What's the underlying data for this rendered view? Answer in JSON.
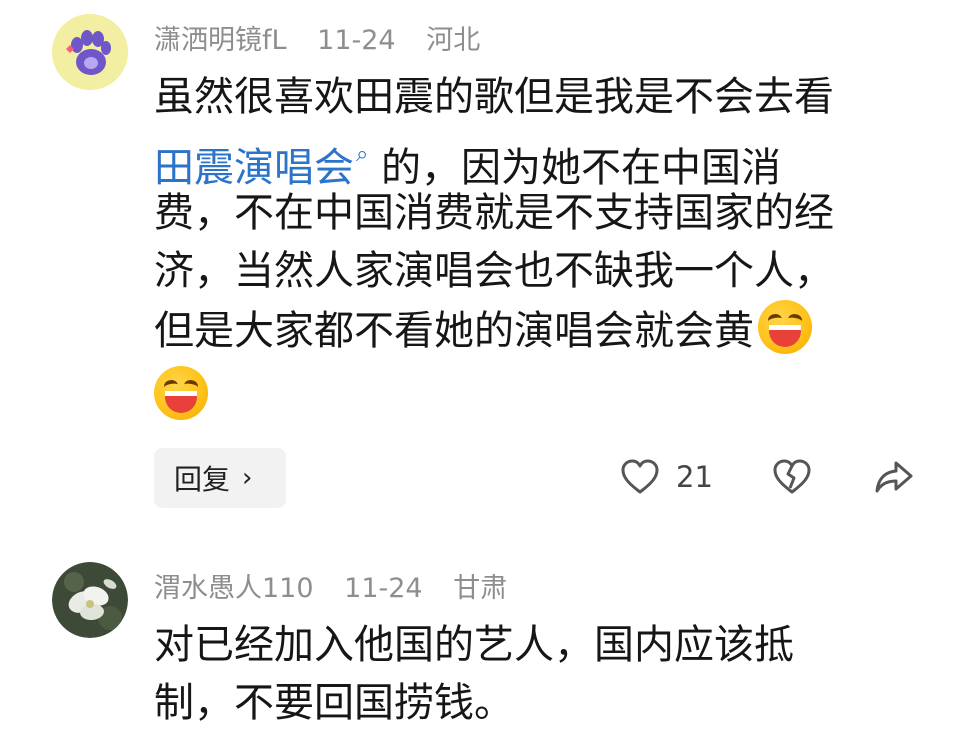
{
  "comments": [
    {
      "username": "潇洒明镜fL",
      "date": "11-24",
      "location": "河北",
      "lines": [
        "虽然很喜欢田震的歌但是我是不会去看",
        "的，因为她不在中国消",
        "费，不在中国消费就是不支持国家的经",
        "济，当然人家演唱会也不缺我一个人，",
        "但是大家都不看她的演唱会就会黄"
      ],
      "link_text": "田震演唱会",
      "emoji": "grinning-squint-face",
      "reply_label": "回复",
      "like_count": "21"
    },
    {
      "username": "渭水愚人110",
      "date": "11-24",
      "location": "甘肃",
      "lines": [
        "对已经加入他国的艺人，国内应该抵",
        "制，不要回国捞钱。"
      ]
    }
  ],
  "colors": {
    "link": "#2b74c9",
    "meta": "#8e8e8e",
    "reply_bg": "#f2f2f2"
  }
}
